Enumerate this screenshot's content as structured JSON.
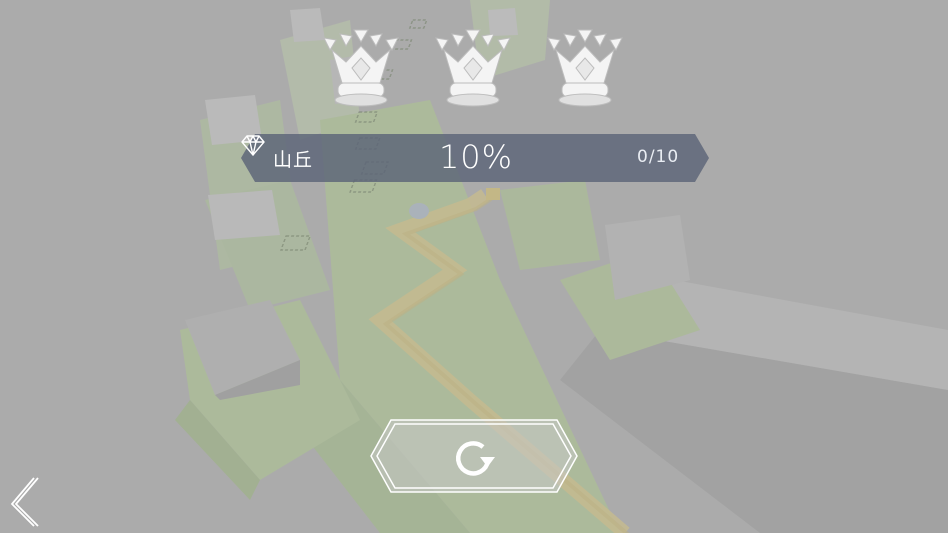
{
  "level": {
    "name": "山丘",
    "progress_percent": "10%",
    "gems": "0/10"
  },
  "crowns": [
    {
      "icon": "crown-icon",
      "earned": false
    },
    {
      "icon": "crown-icon",
      "earned": false
    },
    {
      "icon": "crown-icon",
      "earned": false
    }
  ],
  "controls": {
    "restart_icon": "restart-icon",
    "back_icon": "chevron-left-icon"
  },
  "colors": {
    "background": "#9a9a9a",
    "grass": "#9bb47e",
    "path": "#c9b46a",
    "banner": "#5b6478",
    "crown": "#f2f2f2"
  }
}
